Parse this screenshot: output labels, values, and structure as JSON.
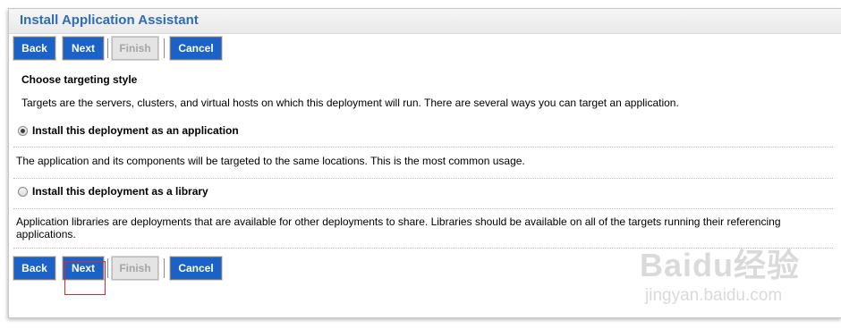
{
  "window": {
    "title": "Install Application Assistant"
  },
  "toolbar": {
    "back_label": "Back",
    "next_label": "Next",
    "finish_label": "Finish",
    "cancel_label": "Cancel",
    "finish_enabled": false
  },
  "content": {
    "heading": "Choose targeting style",
    "intro": "Targets are the servers, clusters, and virtual hosts on which this deployment will run. There are several ways you can target an application.",
    "options": [
      {
        "label": "Install this deployment as an application",
        "selected": true,
        "description": "The application and its components will be targeted to the same locations. This is the most common usage."
      },
      {
        "label": "Install this deployment as a library",
        "selected": false,
        "description": "Application libraries are deployments that are available for other deployments to share. Libraries should be available on all of the targets running their referencing applications."
      }
    ]
  },
  "watermark": {
    "logo": "Baidu经验",
    "url": "jingyan.baidu.com"
  },
  "colors": {
    "title_text": "#2d6db5",
    "button_bg": "#1b62c8",
    "button_disabled_bg": "#e4e4e4",
    "highlight_border": "#d9282f"
  }
}
